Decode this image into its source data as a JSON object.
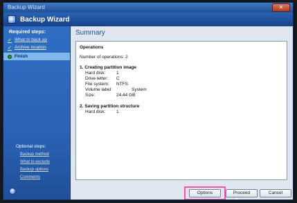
{
  "window": {
    "title": "Backup Wizard",
    "close": "✕"
  },
  "header": {
    "title": "Backup Wizard"
  },
  "sidebar": {
    "required_title": "Required steps:",
    "steps": [
      {
        "label": "What to back up",
        "done": true
      },
      {
        "label": "Archive location",
        "done": true
      },
      {
        "label": "Finish",
        "active": true
      }
    ],
    "optional_title": "Optional steps:",
    "optional": [
      "Backup method",
      "What to exclude",
      "Backup options",
      "Comments"
    ]
  },
  "main": {
    "title": "Summary",
    "operations_heading": "Operations",
    "operations_count": "Number of operations: 2",
    "op1": {
      "heading": "1. Creating partition image",
      "rows": [
        {
          "label": "Hard disk:",
          "value": "1"
        },
        {
          "label": "Drive letter:",
          "value": "C"
        },
        {
          "label": "File system:",
          "value": "NTFS"
        },
        {
          "label": "Volume label:",
          "value": "System"
        },
        {
          "label": "Size:",
          "value": "24.44 GB"
        }
      ]
    },
    "op2": {
      "heading": "2. Saving partition structure",
      "rows": [
        {
          "label": "Hard disk:",
          "value": "1"
        }
      ]
    }
  },
  "buttons": {
    "options": "Options",
    "proceed": "Proceed",
    "cancel": "Cancel"
  },
  "colors": {
    "accent": "#2f6ec4",
    "highlight": "#ff4fa8",
    "title": "#1d4c99"
  }
}
